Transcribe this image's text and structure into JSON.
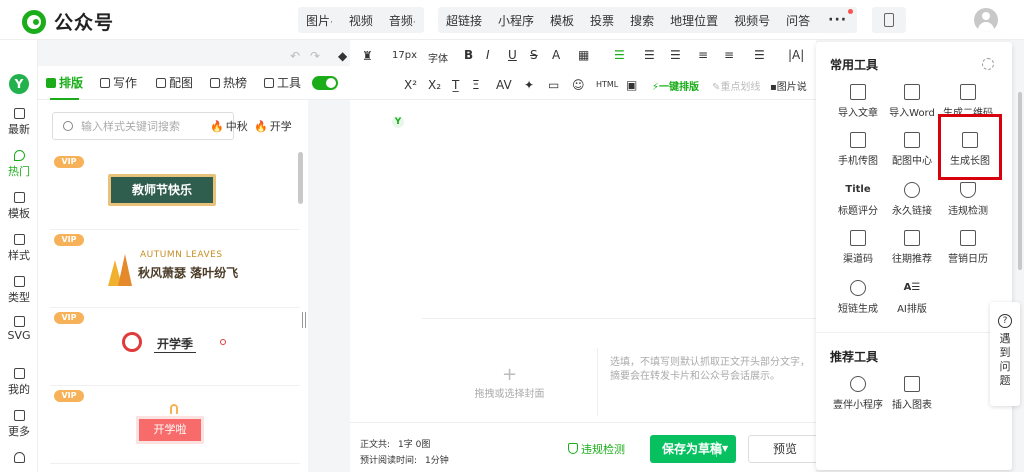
{
  "header": {
    "logo_text": "公众号",
    "group1": [
      "图片",
      "视频",
      "音频"
    ],
    "group2": [
      "超链接",
      "小程序",
      "模板",
      "投票",
      "搜索",
      "地理位置",
      "视频号",
      "问答"
    ],
    "more": "···"
  },
  "rail": {
    "logo": "Y",
    "items": [
      {
        "label": "最新",
        "icon": "new-icon"
      },
      {
        "label": "热门",
        "icon": "hot-icon"
      },
      {
        "label": "模板",
        "icon": "template-icon"
      },
      {
        "label": "样式",
        "icon": "style-icon"
      },
      {
        "label": "类型",
        "icon": "type-icon"
      },
      {
        "label": "SVG",
        "icon": "svg-icon"
      },
      {
        "label": "我的",
        "icon": "user-icon"
      },
      {
        "label": "更多",
        "icon": "grid-icon"
      }
    ]
  },
  "style_tabs": [
    "排版",
    "写作",
    "配图",
    "热榜",
    "工具"
  ],
  "panel": {
    "search_placeholder": "输入样式关键词搜索",
    "hot_tags": [
      "中秋",
      "开学"
    ],
    "vip_badge": "VIP",
    "cards": {
      "c1_title": "教师节快乐",
      "c2_en": "AUTUMN LEAVES",
      "c2_cn": "秋风萧瑟 落叶纷飞",
      "c3_text": "开学季",
      "c4_text": "开学啦"
    }
  },
  "toolbar": {
    "font_size": "17px",
    "font_family": "字体",
    "row1_symbols": [
      "B",
      "I",
      "U",
      "S",
      "A"
    ],
    "row2_symbols": [
      "X²",
      "X₂"
    ],
    "one_click": "一键排版",
    "highlight_line": "重点划线",
    "image_label": "图片说"
  },
  "editor": {
    "cover_text": "拖拽或选择封面",
    "summary_text": "选填，不填写则默认抓取正文开头部分文字，摘要会在转发卡片和公众号会话展示。"
  },
  "bottom": {
    "count_label": "正文共:",
    "count_value": "1字 0图",
    "read_label": "预计阅读时间:",
    "read_value": "1分钟",
    "check": "违规检测",
    "save": "保存为草稿",
    "preview": "预览"
  },
  "tools_panel": {
    "title": "常用工具",
    "tools": [
      {
        "label": "导入文章",
        "icon": "import-icon"
      },
      {
        "label": "导入Word",
        "icon": "word-icon"
      },
      {
        "label": "生成二维码",
        "icon": "qrcode-icon"
      },
      {
        "label": "手机传图",
        "icon": "phone-upload-icon"
      },
      {
        "label": "配图中心",
        "icon": "image-icon"
      },
      {
        "label": "生成长图",
        "icon": "long-image-icon"
      },
      {
        "label": "标题评分",
        "icon": "title-icon"
      },
      {
        "label": "永久链接",
        "icon": "link-icon"
      },
      {
        "label": "违规检测",
        "icon": "shield-icon"
      },
      {
        "label": "渠道码",
        "icon": "channel-qr-icon"
      },
      {
        "label": "往期推荐",
        "icon": "thumbs-up-icon"
      },
      {
        "label": "营销日历",
        "icon": "calendar-icon"
      },
      {
        "label": "短链生成",
        "icon": "short-link-icon"
      },
      {
        "label": "AI排版",
        "icon": "ai-format-icon"
      }
    ],
    "title_icon_text": "Title",
    "ai_icon_text": "A☰",
    "recommend_title": "推荐工具",
    "recommend": [
      {
        "label": "壹伴小程序",
        "icon": "mini-program-icon"
      },
      {
        "label": "插入图表",
        "icon": "chart-icon"
      }
    ],
    "highlight_color": "#d9000d"
  },
  "help": {
    "text": "遇到问题",
    "icon_text": "?"
  },
  "colors": {
    "brand": "#1aad19",
    "save": "#07c160"
  }
}
